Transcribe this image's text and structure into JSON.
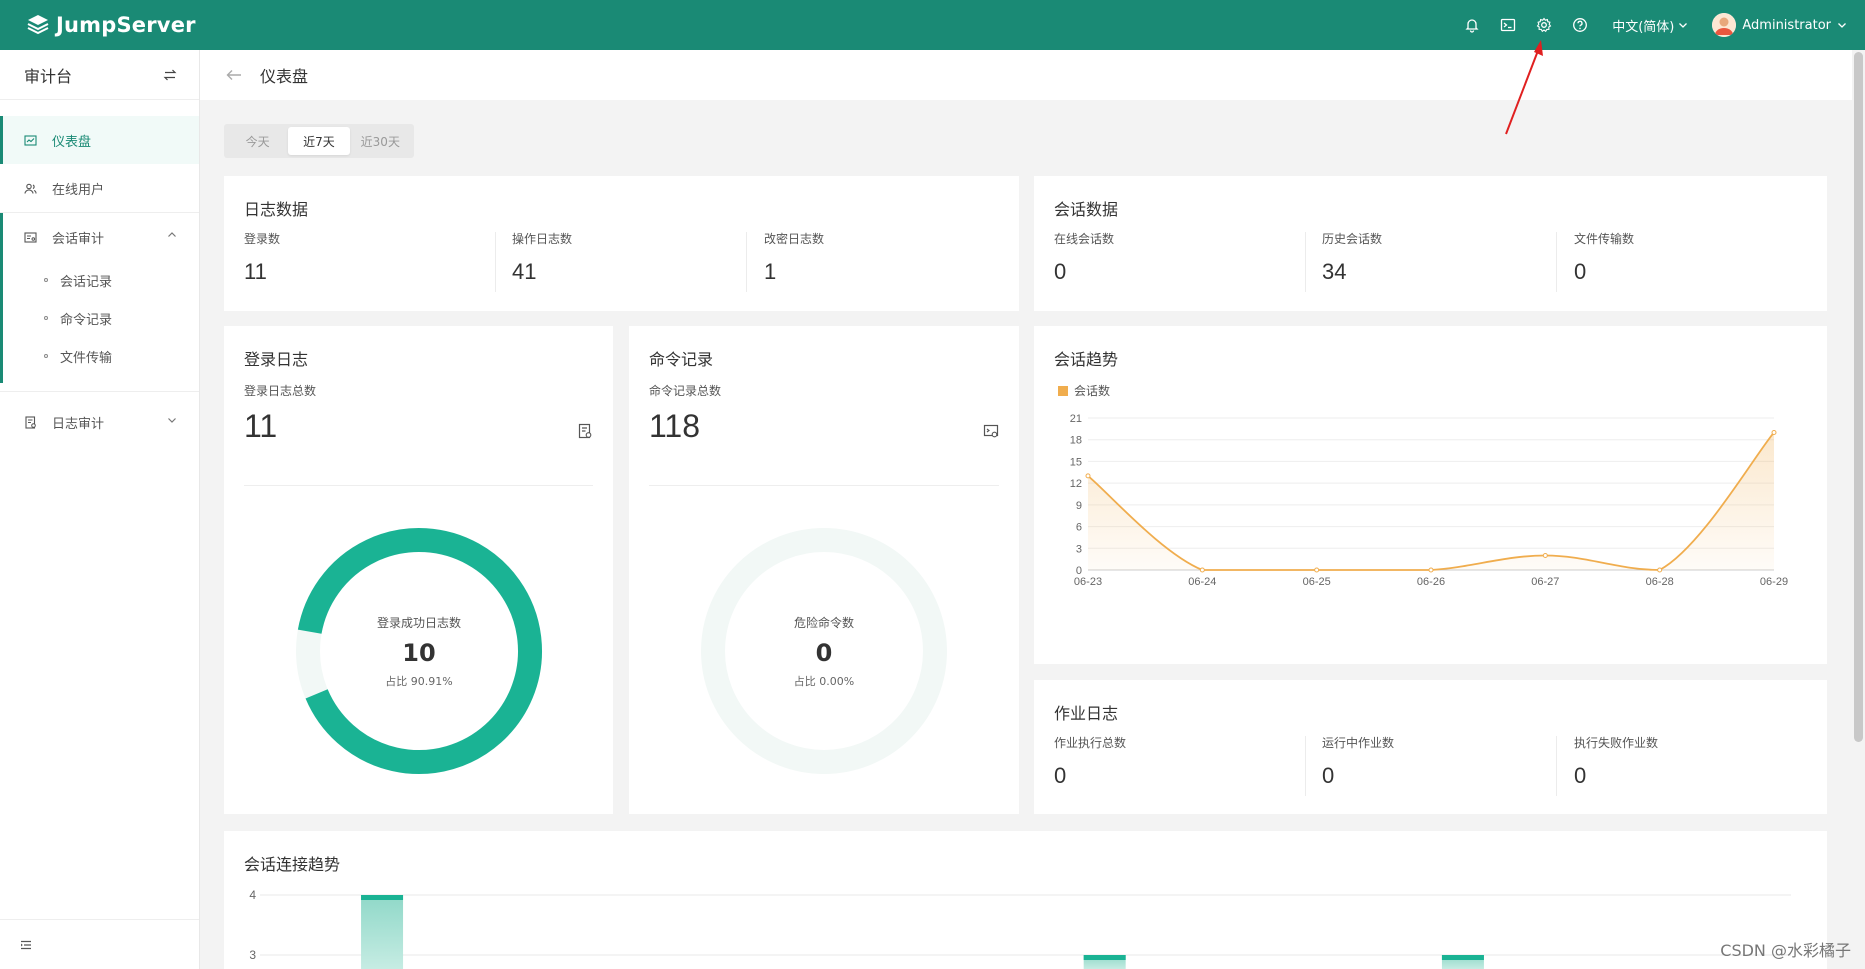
{
  "header": {
    "brand": "JumpServer",
    "language": "中文(简体)",
    "user": "Administrator",
    "icons": [
      "bell-icon",
      "terminal-icon",
      "gear-icon",
      "help-icon"
    ]
  },
  "sidebar": {
    "title": "审计台",
    "items": [
      {
        "label": "仪表盘",
        "icon": "dashboard-icon",
        "active": true
      },
      {
        "label": "在线用户",
        "icon": "users-icon"
      },
      {
        "label": "会话审计",
        "icon": "session-icon",
        "expanded": true,
        "children": [
          {
            "label": "会话记录"
          },
          {
            "label": "命令记录"
          },
          {
            "label": "文件传输"
          }
        ]
      },
      {
        "label": "日志审计",
        "icon": "log-icon"
      }
    ]
  },
  "page": {
    "title": "仪表盘"
  },
  "date_tabs": {
    "options": [
      "今天",
      "近7天",
      "近30天"
    ],
    "selected": "近7天"
  },
  "log_data": {
    "title": "日志数据",
    "stats": [
      {
        "label": "登录数",
        "value": "11"
      },
      {
        "label": "操作日志数",
        "value": "41"
      },
      {
        "label": "改密日志数",
        "value": "1"
      }
    ]
  },
  "session_data": {
    "title": "会话数据",
    "stats": [
      {
        "label": "在线会话数",
        "value": "0"
      },
      {
        "label": "历史会话数",
        "value": "34"
      },
      {
        "label": "文件传输数",
        "value": "0"
      }
    ]
  },
  "login_log": {
    "title": "登录日志",
    "total_label": "登录日志总数",
    "total": "11",
    "donut_title": "登录成功日志数",
    "donut_value": "10",
    "donut_percent": "占比 90.91%",
    "fraction": 0.9091
  },
  "command_log": {
    "title": "命令记录",
    "total_label": "命令记录总数",
    "total": "118",
    "donut_title": "危险命令数",
    "donut_value": "0",
    "donut_percent": "占比 0.00%",
    "fraction": 0
  },
  "session_trend": {
    "title": "会话趋势",
    "legend": "会话数"
  },
  "job_log": {
    "title": "作业日志",
    "stats": [
      {
        "label": "作业执行总数",
        "value": "0"
      },
      {
        "label": "运行中作业数",
        "value": "0"
      },
      {
        "label": "执行失败作业数",
        "value": "0"
      }
    ]
  },
  "connection_trend": {
    "title": "会话连接趋势"
  },
  "watermark": "CSDN @水彩橘子",
  "colors": {
    "brand": "#1a8a75",
    "donut": "#1ab394",
    "trend_line": "#f0ad4e",
    "bar": "#1ab394"
  },
  "chart_data": [
    {
      "type": "area",
      "categories": [
        "06-23",
        "06-24",
        "06-25",
        "06-26",
        "06-27",
        "06-28",
        "06-29"
      ],
      "series": [
        {
          "name": "会话数",
          "values": [
            13,
            0,
            0,
            0,
            2,
            0,
            19
          ]
        }
      ],
      "ylim": [
        0,
        21
      ],
      "yticks": [
        0,
        3,
        6,
        9,
        12,
        15,
        18,
        21
      ],
      "legend": "top-left",
      "grid": true
    },
    {
      "type": "bar",
      "yticks_visible": [
        3,
        4
      ],
      "grid": true,
      "bars": [
        {
          "position": "first",
          "value": 4
        },
        {
          "position": "middle",
          "value": 3
        },
        {
          "position": "last",
          "value": 3
        }
      ]
    }
  ]
}
